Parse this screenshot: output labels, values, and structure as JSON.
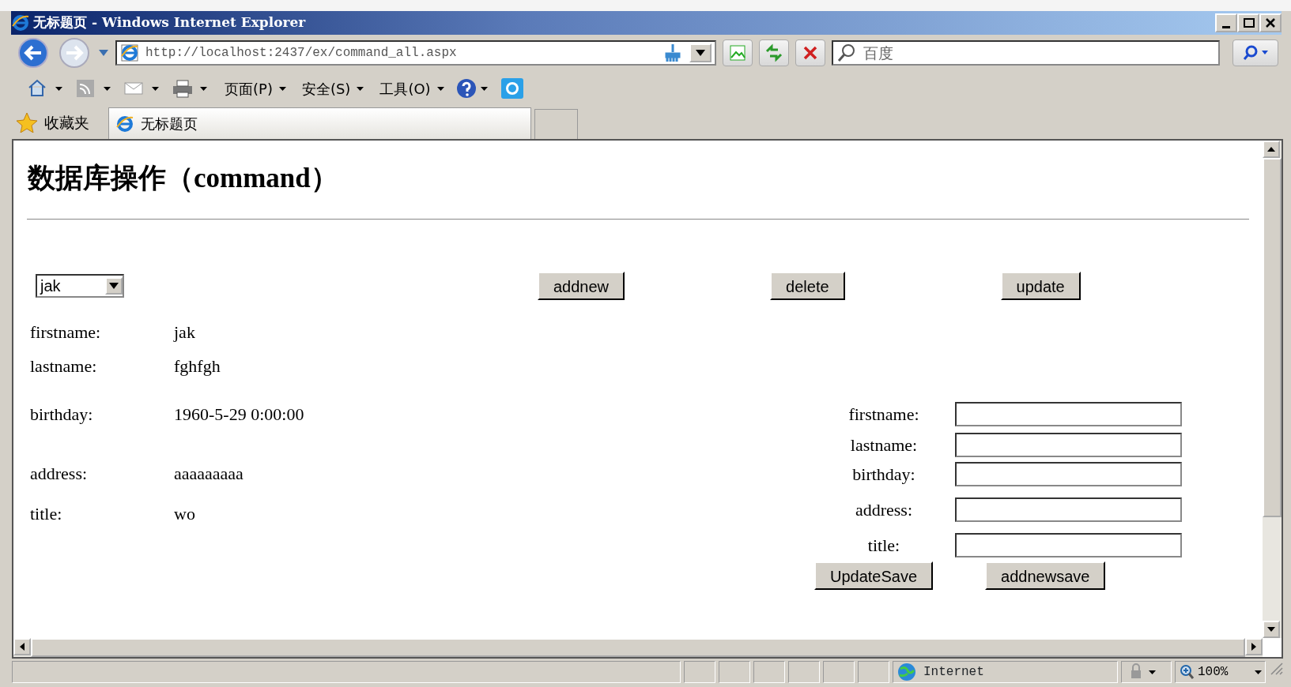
{
  "window": {
    "title": "无标题页 - Windows Internet Explorer"
  },
  "address_bar": {
    "url": "http://localhost:2437/ex/command_all.aspx"
  },
  "search": {
    "placeholder": "百度"
  },
  "command_bar": [
    "页面(P)",
    "安全(S)",
    "工具(O)"
  ],
  "favorites": {
    "label": "收藏夹"
  },
  "tabs": [
    {
      "label": "无标题页",
      "selected": true
    }
  ],
  "page": {
    "heading": "数据库操作（command）",
    "select": {
      "value": "jak"
    },
    "buttons": [
      "addnew",
      "delete",
      "update"
    ],
    "details": [
      {
        "label": "firstname:",
        "value": "jak"
      },
      {
        "label": "lastname:",
        "value": "fghfgh"
      },
      {
        "label": "birthday:",
        "value": "1960-5-29 0:00:00"
      },
      {
        "label": "address:",
        "value": "aaaaaaaaa"
      },
      {
        "label": "title:",
        "value": "wo"
      }
    ],
    "form": {
      "fields": [
        {
          "label": "firstname:"
        },
        {
          "label": "lastname:"
        },
        {
          "label": "birthday:"
        },
        {
          "label": "address:"
        },
        {
          "label": "title:"
        }
      ],
      "buttons": [
        "UpdateSave",
        "addnewsave"
      ]
    }
  },
  "status_bar": {
    "zone": "Internet",
    "zoom": "100%"
  }
}
